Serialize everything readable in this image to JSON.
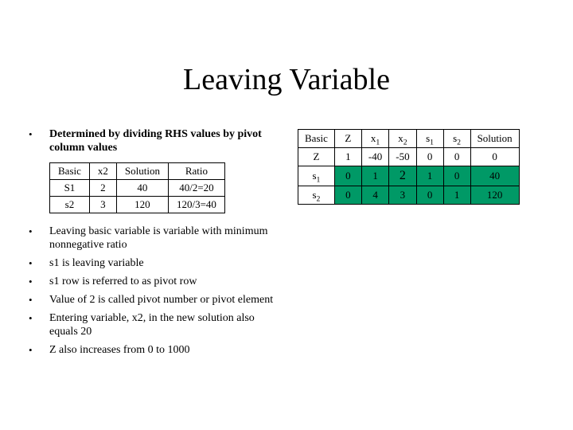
{
  "title": "Leaving Variable",
  "bullets": {
    "intro": "Determined by dividing RHS values by pivot column values",
    "b1": "Leaving basic variable is variable with minimum nonnegative ratio",
    "b2": "s1 is leaving variable",
    "b3": "s1 row is referred to as pivot row",
    "b4": "Value of 2 is called pivot number or pivot element",
    "b5": "Entering variable, x2, in the new solution also equals 20",
    "b6": "Z also increases from 0 to 1000"
  },
  "ratio_table": {
    "headers": {
      "c0": "Basic",
      "c1": "x2",
      "c2": "Solution",
      "c3": "Ratio"
    },
    "r1": {
      "c0": "S1",
      "c1": "2",
      "c2": "40",
      "c3": "40/2=20"
    },
    "r2": {
      "c0": "s2",
      "c1": "3",
      "c2": "120",
      "c3": "120/3=40"
    }
  },
  "tableau": {
    "headers": {
      "c0": "Basic",
      "c1": "Z",
      "c2": "x1",
      "c3": "x2",
      "c4": "s1",
      "c5": "s2",
      "c6": "Solution"
    },
    "rZ": {
      "c0": "Z",
      "c1": "1",
      "c2": "-40",
      "c3": "-50",
      "c4": "0",
      "c5": "0",
      "c6": "0"
    },
    "rS1": {
      "c0": "s1",
      "c1": "0",
      "c2": "1",
      "c3": "2",
      "c4": "1",
      "c5": "0",
      "c6": "40"
    },
    "rS2": {
      "c0": "s2",
      "c1": "0",
      "c2": "4",
      "c3": "3",
      "c4": "0",
      "c5": "1",
      "c6": "120"
    }
  },
  "chart_data": {
    "type": "table",
    "tables": [
      {
        "name": "ratio",
        "columns": [
          "Basic",
          "x2",
          "Solution",
          "Ratio"
        ],
        "rows": [
          [
            "S1",
            2,
            40,
            "40/2=20"
          ],
          [
            "s2",
            3,
            120,
            "120/3=40"
          ]
        ]
      },
      {
        "name": "simplex_tableau",
        "columns": [
          "Basic",
          "Z",
          "x1",
          "x2",
          "s1",
          "s2",
          "Solution"
        ],
        "rows": [
          [
            "Z",
            1,
            -40,
            -50,
            0,
            0,
            0
          ],
          [
            "s1",
            0,
            1,
            2,
            1,
            0,
            40
          ],
          [
            "s2",
            0,
            4,
            3,
            0,
            1,
            120
          ]
        ],
        "pivot_row": 1,
        "pivot_col": 3
      }
    ]
  }
}
